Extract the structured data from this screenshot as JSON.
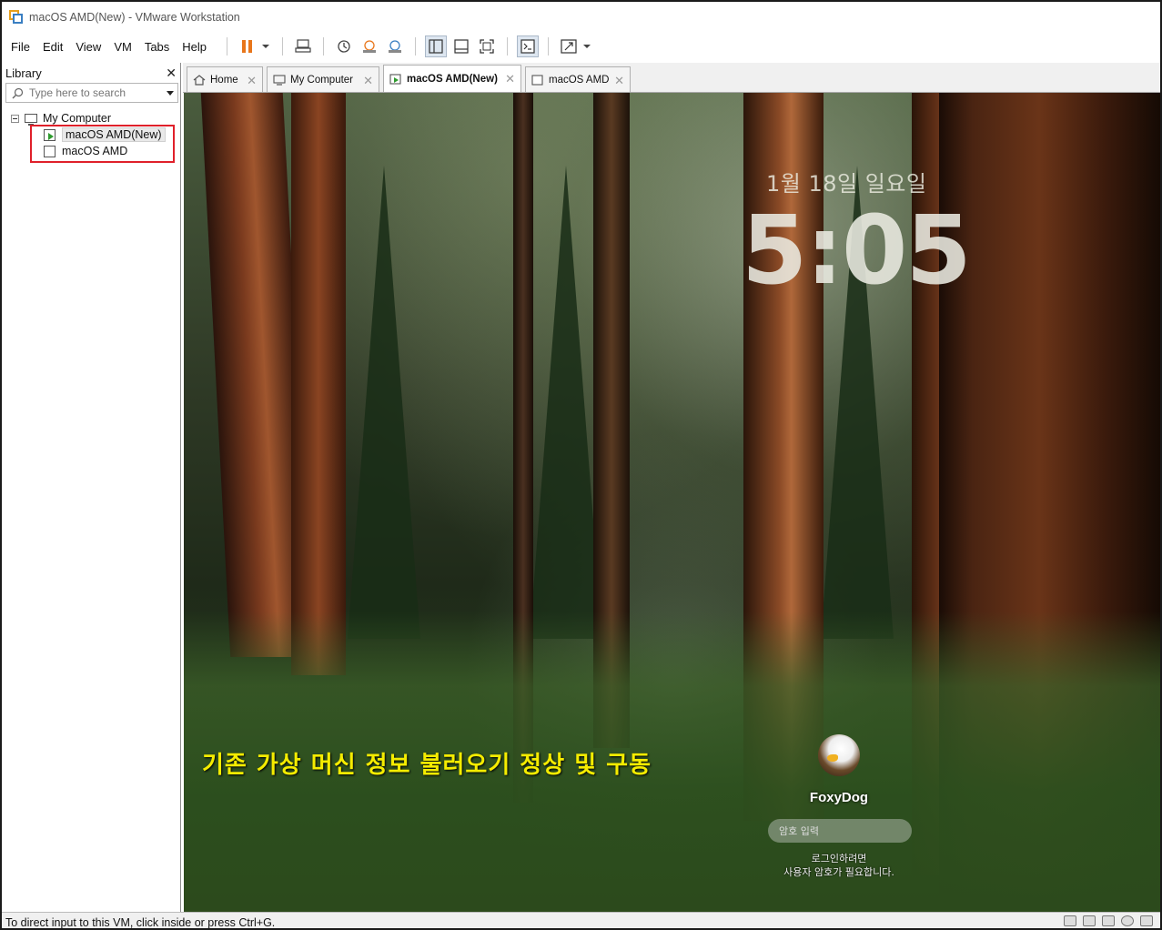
{
  "window": {
    "title": "macOS AMD(New) - VMware Workstation"
  },
  "menu": {
    "items": [
      {
        "label": "File",
        "mnemonic": "F"
      },
      {
        "label": "Edit",
        "mnemonic": "E"
      },
      {
        "label": "View",
        "mnemonic": "V"
      },
      {
        "label": "VM",
        "mnemonic": "M"
      },
      {
        "label": "Tabs",
        "mnemonic": "T"
      },
      {
        "label": "Help",
        "mnemonic": "H"
      }
    ]
  },
  "toolbar": {
    "icons": [
      "pause-icon",
      "send-ctrl-alt-del-icon",
      "snapshot-icon",
      "revert-snapshot-icon",
      "snapshot-manager-icon",
      "show-library-icon",
      "thumbnail-bar-icon",
      "fullscreen-icon",
      "console-view-icon",
      "stretch-guest-icon"
    ],
    "accent_color": "#e8761b"
  },
  "library": {
    "title": "Library",
    "search_placeholder": "Type here to search",
    "tree": {
      "root": "My Computer",
      "vms": [
        {
          "name": "macOS AMD(New)",
          "state": "running",
          "selected": true
        },
        {
          "name": "macOS AMD",
          "state": "stopped",
          "selected": false
        }
      ]
    }
  },
  "tabs": [
    {
      "label": "Home",
      "icon": "home-icon",
      "active": false
    },
    {
      "label": "My Computer",
      "icon": "computer-icon",
      "active": false
    },
    {
      "label": "macOS AMD(New)",
      "icon": "vm-running-icon",
      "active": true
    },
    {
      "label": "macOS AMD",
      "icon": "vm-icon",
      "active": false
    }
  ],
  "vm_screen": {
    "date": "1월 18일 일요일",
    "time": "5:05",
    "caption": "기존 가상 머신 정보 불러오기 정상 및 구동",
    "caption_color": "#f5ec00",
    "user_name": "FoxyDog",
    "password_placeholder": "암호 입력",
    "hint_line1": "로그인하려면",
    "hint_line2": "사용자 암호가 필요합니다."
  },
  "status": {
    "text": "To direct input to this VM, click inside or press Ctrl+G."
  },
  "highlight_color": "#e0202a"
}
